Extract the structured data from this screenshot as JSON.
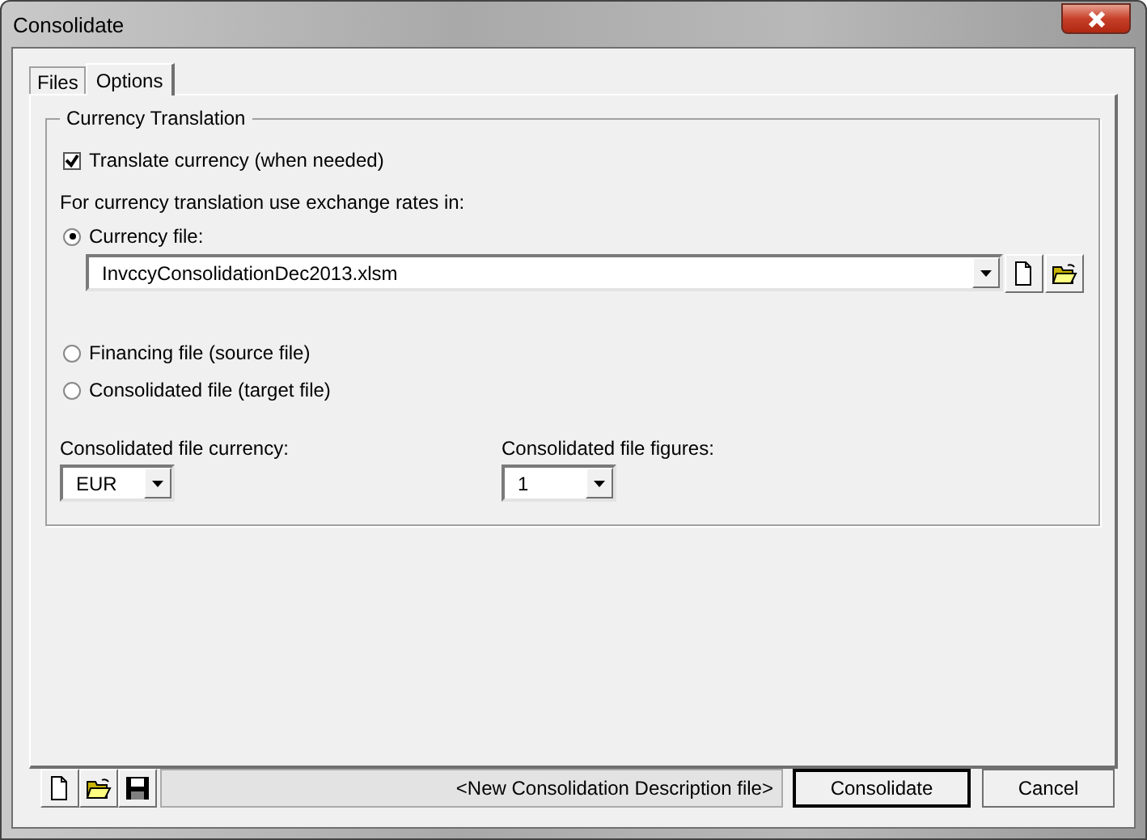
{
  "window": {
    "title": "Consolidate"
  },
  "tabs": [
    {
      "label": "Files",
      "selected": false
    },
    {
      "label": "Options",
      "selected": true
    }
  ],
  "group": {
    "title": "Currency Translation",
    "translate": {
      "label": "Translate currency (when needed)",
      "checked": true
    },
    "rates_label": "For currency translation use exchange rates in:",
    "sources": [
      {
        "label": "Currency file:",
        "selected": true
      },
      {
        "label": "Financing file (source file)",
        "selected": false
      },
      {
        "label": "Consolidated file (target file)",
        "selected": false
      }
    ],
    "currency_file": {
      "value": "InvccyConsolidationDec2013.xlsm"
    },
    "currency": {
      "label": "Consolidated file currency:",
      "value": "EUR"
    },
    "figures": {
      "label": "Consolidated file figures:",
      "value": "1"
    }
  },
  "footer": {
    "description_file": "<New Consolidation Description file>",
    "buttons": [
      "Consolidate",
      "Cancel"
    ]
  }
}
